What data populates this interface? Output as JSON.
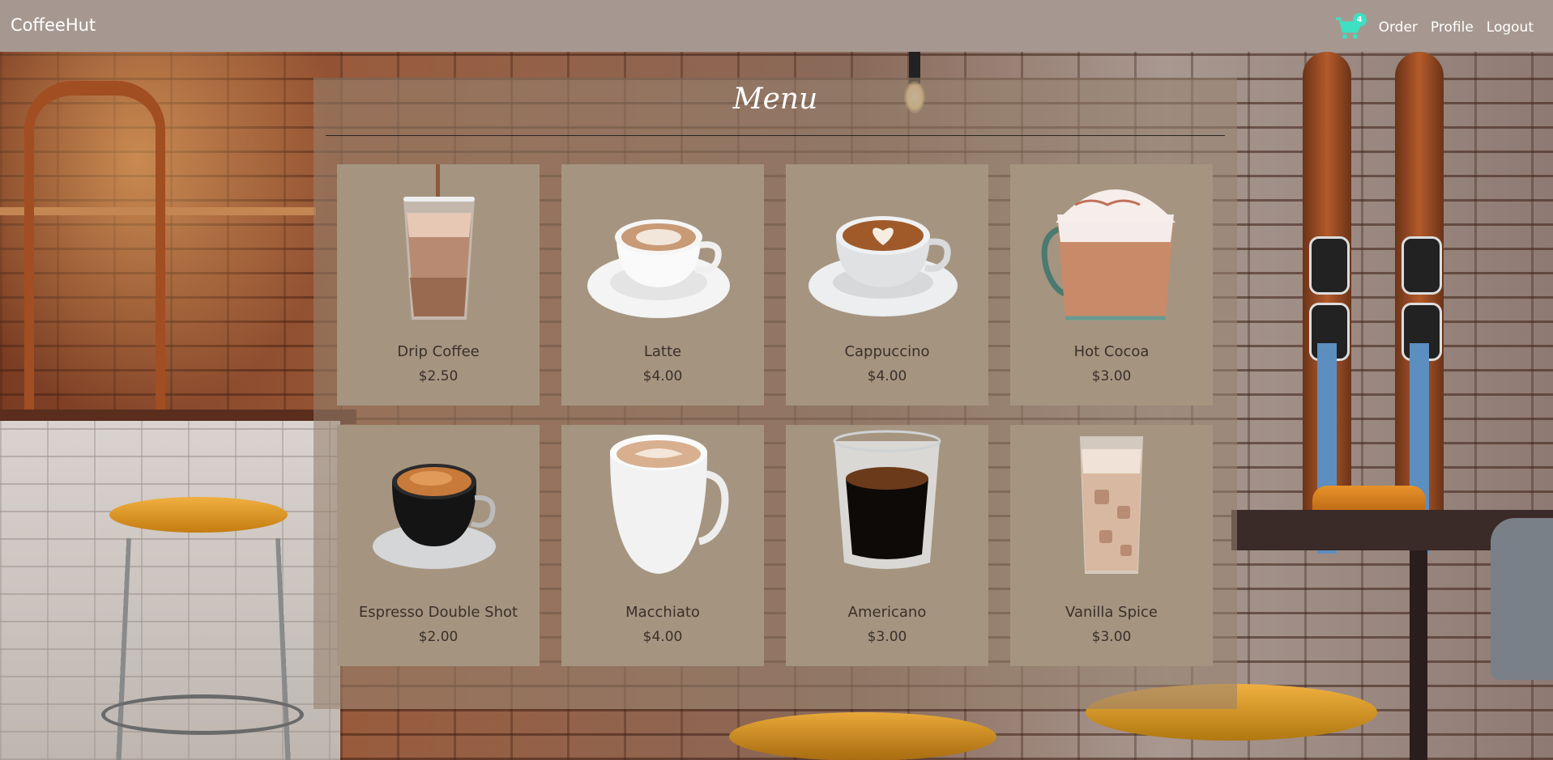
{
  "navbar": {
    "brand": "CoffeeHut",
    "cart_count": "4",
    "cart_icon": "shopping-cart-icon",
    "links": [
      "Order",
      "Profile",
      "Logout"
    ]
  },
  "menu": {
    "title": "Menu",
    "items": [
      {
        "name": "Drip Coffee",
        "price": "$2.50",
        "icon": "iced-coffee-glass"
      },
      {
        "name": "Latte",
        "price": "$4.00",
        "icon": "latte-cup"
      },
      {
        "name": "Cappuccino",
        "price": "$4.00",
        "icon": "cappuccino-cup"
      },
      {
        "name": "Hot Cocoa",
        "price": "$3.00",
        "icon": "hot-cocoa-mug"
      },
      {
        "name": "Espresso Double Shot",
        "price": "$2.00",
        "icon": "espresso-cup"
      },
      {
        "name": "Macchiato",
        "price": "$4.00",
        "icon": "macchiato-mug"
      },
      {
        "name": "Americano",
        "price": "$3.00",
        "icon": "americano-glass"
      },
      {
        "name": "Vanilla Spice",
        "price": "$3.00",
        "icon": "iced-vanilla-glass"
      }
    ]
  },
  "colors": {
    "navbar_bg": "#a69890",
    "card_bg": "#a59580",
    "cart_accent": "#3de0c2"
  }
}
